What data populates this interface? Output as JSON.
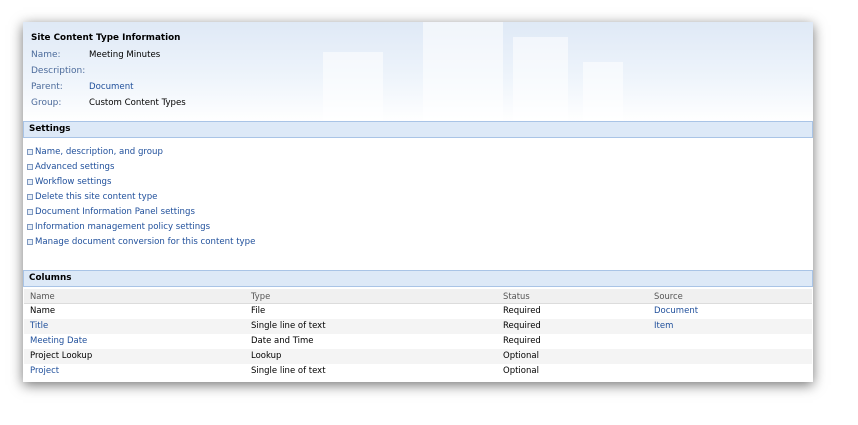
{
  "info": {
    "title": "Site Content Type Information",
    "fields": [
      {
        "label": "Name:",
        "value": "Meeting Minutes",
        "link": false
      },
      {
        "label": "Description:",
        "value": "",
        "link": false
      },
      {
        "label": "Parent:",
        "value": "Document",
        "link": true
      },
      {
        "label": "Group:",
        "value": "Custom Content Types",
        "link": false
      }
    ]
  },
  "settings": {
    "title": "Settings",
    "items": [
      "Name, description, and group",
      "Advanced settings",
      "Workflow settings",
      "Delete this site content type",
      "Document Information Panel settings",
      "Information management policy settings",
      "Manage document conversion for this content type"
    ]
  },
  "columns": {
    "title": "Columns",
    "headers": [
      "Name",
      "Type",
      "Status",
      "Source"
    ],
    "rows": [
      {
        "name": "Name",
        "name_link": false,
        "type": "File",
        "status": "Required",
        "source": "Document"
      },
      {
        "name": "Title",
        "name_link": true,
        "type": "Single line of text",
        "status": "Required",
        "source": "Item"
      },
      {
        "name": "Meeting Date",
        "name_link": true,
        "type": "Date and Time",
        "status": "Required",
        "source": ""
      },
      {
        "name": "Project Lookup",
        "name_link": false,
        "type": "Lookup",
        "status": "Optional",
        "source": ""
      },
      {
        "name": "Project",
        "name_link": true,
        "type": "Single line of text",
        "status": "Optional",
        "source": ""
      }
    ]
  },
  "colors": {
    "link": "#1f4f9b",
    "label": "#4c6b9b",
    "section_bg": "#dde9f7",
    "section_border": "#a9c4e6"
  }
}
